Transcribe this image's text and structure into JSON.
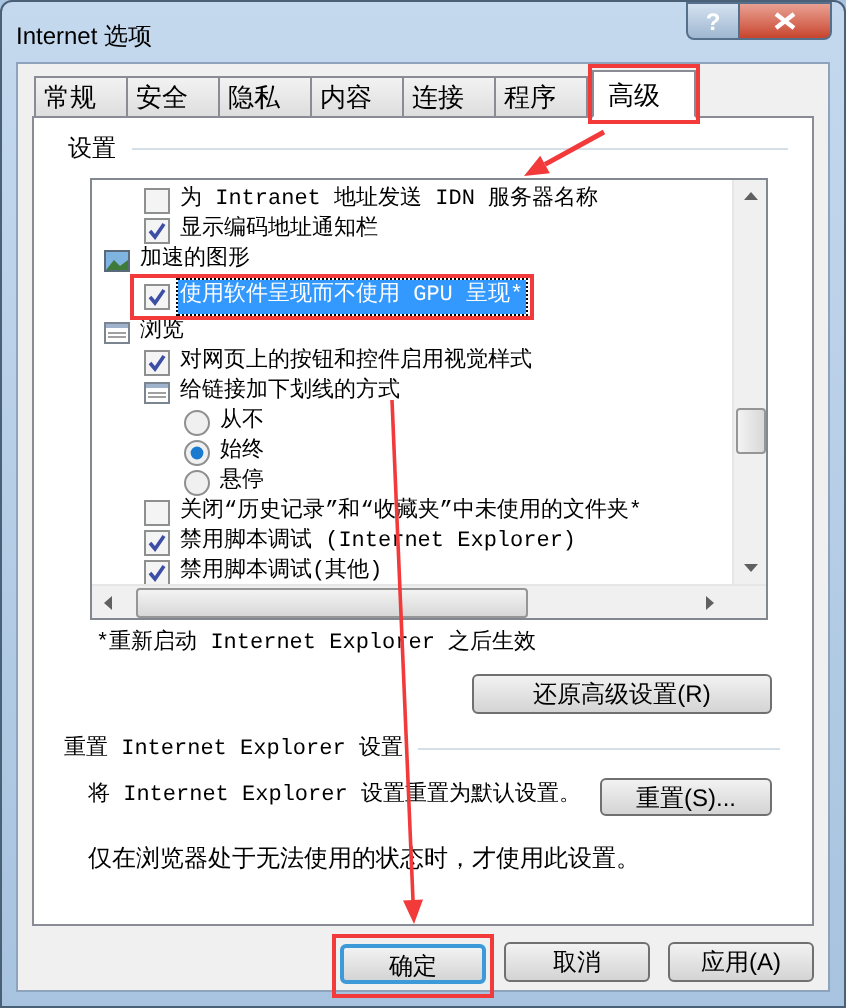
{
  "window": {
    "title": "Internet 选项",
    "help": "?"
  },
  "tabs": [
    {
      "label": "常规",
      "selected": false
    },
    {
      "label": "安全",
      "selected": false
    },
    {
      "label": "隐私",
      "selected": false
    },
    {
      "label": "内容",
      "selected": false
    },
    {
      "label": "连接",
      "selected": false
    },
    {
      "label": "程序",
      "selected": false
    },
    {
      "label": "高级",
      "selected": true
    }
  ],
  "settings": {
    "label": "设置",
    "items": [
      {
        "kind": "checkbox",
        "label": "为 Intranet 地址发送 IDN 服务器名称",
        "checked": false,
        "selected": false
      },
      {
        "kind": "checkbox",
        "label": "显示编码地址通知栏",
        "checked": true,
        "selected": false
      },
      {
        "kind": "imagegroup",
        "label": "加速的图形",
        "selected": false,
        "children": [
          {
            "kind": "checkbox",
            "label": "使用软件呈现而不使用 GPU 呈现*",
            "checked": true,
            "selected": true
          }
        ]
      },
      {
        "kind": "pagegroup",
        "label": "浏览",
        "selected": false,
        "children": [
          {
            "kind": "checkbox",
            "label": "对网页上的按钮和控件启用视觉样式",
            "checked": true,
            "selected": false
          },
          {
            "kind": "pagegroup",
            "label": "给链接加下划线的方式",
            "selected": false,
            "children": [
              {
                "kind": "radio",
                "label": "从不",
                "checked": false,
                "selected": false
              },
              {
                "kind": "radio",
                "label": "始终",
                "checked": true,
                "selected": false
              },
              {
                "kind": "radio",
                "label": "悬停",
                "checked": false,
                "selected": false
              }
            ]
          },
          {
            "kind": "checkbox",
            "label": "关闭“历史记录”和“收藏夹”中未使用的文件夹*",
            "checked": false,
            "selected": false
          },
          {
            "kind": "checkbox",
            "label": "禁用脚本调试 (Internet Explorer)",
            "checked": true,
            "selected": false
          },
          {
            "kind": "checkbox",
            "label": "禁用脚本调试(其他)",
            "checked": true,
            "selected": false
          }
        ]
      }
    ]
  },
  "note": "*重新启动 Internet Explorer 之后生效",
  "restore_button": "还原高级设置(R)",
  "reset": {
    "title": "重置 Internet Explorer 设置",
    "description": "将 Internet Explorer 设置重置为默认设置。",
    "button": "重置(S)...",
    "note": "仅在浏览器处于无法使用的状态时，才使用此设置。"
  },
  "buttons": [
    {
      "label": "确定",
      "default": true
    },
    {
      "label": "取消",
      "default": false
    },
    {
      "label": "应用(A)",
      "default": false
    }
  ]
}
